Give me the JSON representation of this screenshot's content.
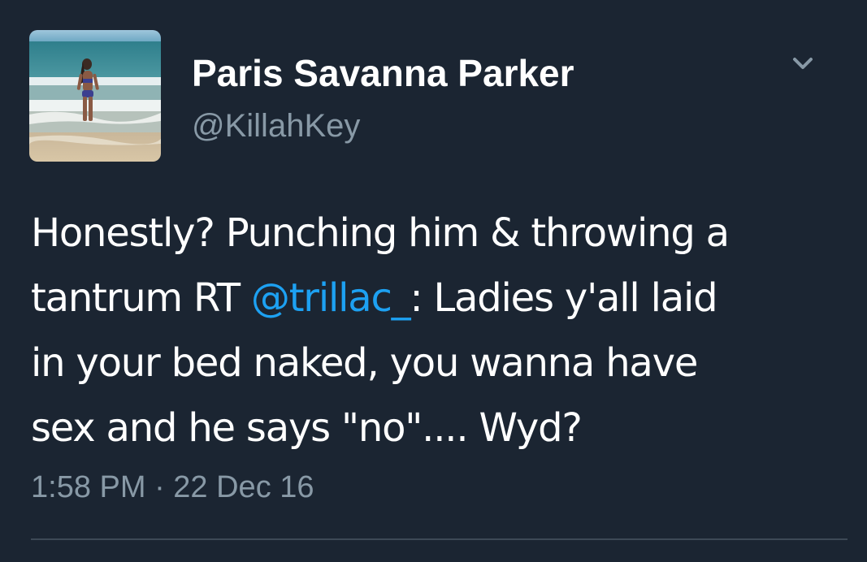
{
  "tweet": {
    "author": {
      "display_name": "Paris Savanna Parker",
      "handle": "@KillahKey",
      "avatar_icon": "beach-photo-avatar"
    },
    "menu_icon": "chevron-down-icon",
    "body": {
      "line1": "Honestly? Punching him & throwing a",
      "line2_before": "tantrum RT ",
      "mention": "@trillac_",
      "line2_after": ": Ladies y'all laid",
      "line3": "in your bed naked, you wanna have",
      "line4": "sex and he says \"no\".... Wyd?"
    },
    "timestamp": "1:58 PM · 22 Dec 16"
  },
  "colors": {
    "background": "#1b2532",
    "text": "#ffffff",
    "secondary": "#8899a6",
    "link": "#1da1f2",
    "divider": "#3d4956"
  }
}
